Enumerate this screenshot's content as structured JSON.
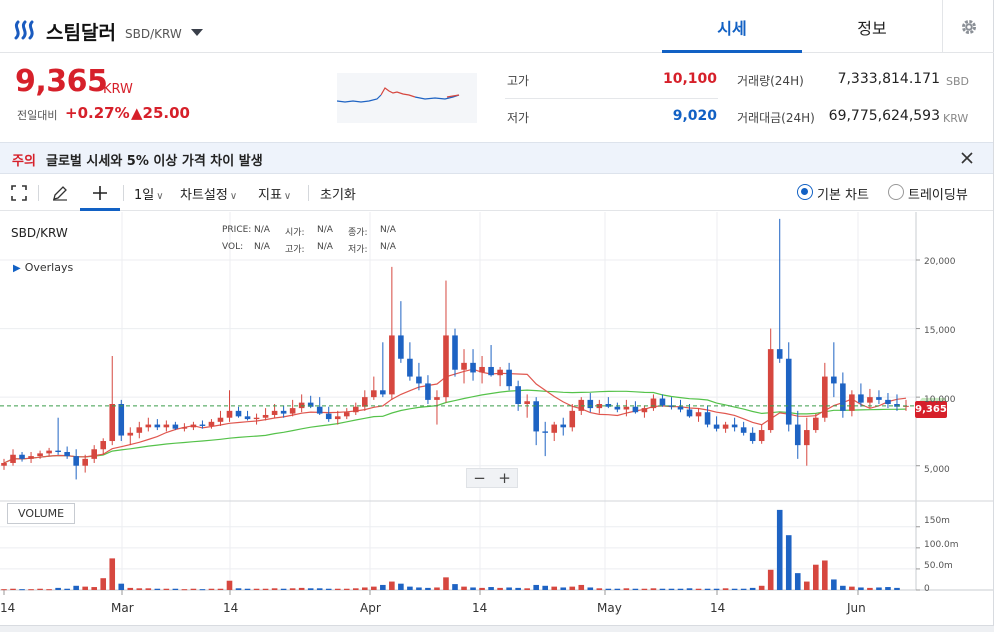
{
  "header": {
    "coin_name": "스팀달러",
    "pair": "SBD/KRW",
    "tabs": [
      "시세",
      "정보"
    ]
  },
  "summary": {
    "price": "9,365",
    "unit": "KRW",
    "change_label": "전일대비",
    "change_pct": "+0.27%",
    "change_abs": "▲25.00",
    "high_label": "고가",
    "high": "10,100",
    "low_label": "저가",
    "low": "9,020",
    "volume_label": "거래량(24H)",
    "volume": "7,333,814.171",
    "volume_unit": "SBD",
    "value_label": "거래대금(24H)",
    "value": "69,775,624,593",
    "value_unit": "KRW"
  },
  "notice": {
    "tag": "주의",
    "text": "글로벌 시세와 5% 이상 가격 차이 발생"
  },
  "toolbar": {
    "interval": "1일",
    "chart_settings": "차트설정",
    "indicators": "지표",
    "reset": "초기화",
    "basic_chart": "기본 차트",
    "tradingview": "트레이딩뷰"
  },
  "chart": {
    "pair": "SBD/KRW",
    "overlays": "Overlays",
    "ohlc": {
      "price_label": "PRICE:",
      "price": "N/A",
      "open_label": "시가:",
      "open": "N/A",
      "close_label": "종가:",
      "close": "N/A",
      "vol_label": "VOL:",
      "vol": "N/A",
      "high_label": "고가:",
      "high": "N/A",
      "low_label": "저가:",
      "low": "N/A"
    },
    "volume_label": "VOLUME",
    "last_price": "9,365",
    "zoom_minus": "−",
    "zoom_plus": "+",
    "y_ticks": [
      "20,000",
      "15,000",
      "10,000",
      "5,000"
    ],
    "vol_ticks": [
      "150m",
      "100.0m",
      "50.0m",
      "0"
    ],
    "x_ticks": [
      "14",
      "Mar",
      "14",
      "Apr",
      "14",
      "May",
      "14",
      "Jun"
    ],
    "colors": {
      "up": "#d6473f",
      "down": "#1e63c3",
      "ma_short": "#e0574f",
      "ma_long": "#55c24a",
      "accent": "#1261c4"
    }
  },
  "chart_data": {
    "type": "candlestick",
    "series": [
      {
        "name": "OHLC",
        "values": [
          [
            5000,
            5500,
            4700,
            5200
          ],
          [
            5200,
            6200,
            5000,
            5800
          ],
          [
            5800,
            6000,
            5300,
            5500
          ],
          [
            5500,
            6000,
            5200,
            5700
          ],
          [
            5700,
            6100,
            5500,
            5900
          ],
          [
            5900,
            6300,
            5700,
            6100
          ],
          [
            6100,
            8500,
            5800,
            6000
          ],
          [
            6000,
            6400,
            5500,
            5700
          ],
          [
            5700,
            6200,
            4000,
            5000
          ],
          [
            5000,
            5800,
            4500,
            5500
          ],
          [
            5500,
            6500,
            5200,
            6200
          ],
          [
            6200,
            7000,
            5800,
            6800
          ],
          [
            6800,
            13000,
            6500,
            9500
          ],
          [
            9500,
            9800,
            6800,
            7200
          ],
          [
            7200,
            7800,
            6500,
            7400
          ],
          [
            7400,
            8200,
            7000,
            7800
          ],
          [
            7800,
            8500,
            7500,
            8000
          ],
          [
            8000,
            8400,
            7600,
            7800
          ],
          [
            7800,
            8300,
            7500,
            8000
          ],
          [
            8000,
            8200,
            7600,
            7700
          ],
          [
            7700,
            8100,
            7500,
            7800
          ],
          [
            7800,
            8200,
            7600,
            8000
          ],
          [
            8000,
            8300,
            7700,
            7900
          ],
          [
            7900,
            8400,
            7700,
            8200
          ],
          [
            8200,
            9000,
            7900,
            8500
          ],
          [
            8500,
            10500,
            8200,
            9000
          ],
          [
            9000,
            9300,
            8500,
            8600
          ],
          [
            8600,
            9000,
            8300,
            8400
          ],
          [
            8400,
            8800,
            8000,
            8500
          ],
          [
            8500,
            9200,
            8300,
            8700
          ],
          [
            8700,
            9500,
            8500,
            9000
          ],
          [
            9000,
            9400,
            8500,
            8800
          ],
          [
            8800,
            9800,
            8600,
            9200
          ],
          [
            9200,
            10200,
            8900,
            9600
          ],
          [
            9600,
            10100,
            9200,
            9300
          ],
          [
            9300,
            10000,
            8700,
            8800
          ],
          [
            8800,
            9300,
            8200,
            8400
          ],
          [
            8400,
            9000,
            8000,
            8600
          ],
          [
            8600,
            9200,
            8400,
            8900
          ],
          [
            8900,
            9600,
            8700,
            9300
          ],
          [
            9300,
            10500,
            9000,
            10000
          ],
          [
            10000,
            11500,
            9800,
            10500
          ],
          [
            10500,
            14000,
            10000,
            10200
          ],
          [
            10200,
            19500,
            9800,
            14500
          ],
          [
            14500,
            17000,
            12500,
            12800
          ],
          [
            12800,
            14000,
            11200,
            11500
          ],
          [
            11500,
            12500,
            10500,
            11000
          ],
          [
            11000,
            11600,
            9500,
            9800
          ],
          [
            9800,
            10500,
            8000,
            10000
          ],
          [
            10000,
            18500,
            9600,
            14500
          ],
          [
            14500,
            15000,
            11500,
            12000
          ],
          [
            12000,
            13500,
            11000,
            12500
          ],
          [
            12500,
            13500,
            11200,
            11800
          ],
          [
            11800,
            13000,
            11000,
            12200
          ],
          [
            12200,
            13800,
            11500,
            11600
          ],
          [
            11600,
            12200,
            10800,
            12000
          ],
          [
            12000,
            12500,
            10500,
            10800
          ],
          [
            10800,
            11200,
            9000,
            9500
          ],
          [
            9500,
            10200,
            8500,
            9700
          ],
          [
            9700,
            10000,
            6500,
            7500
          ],
          [
            7500,
            8200,
            5700,
            7400
          ],
          [
            7400,
            8200,
            6800,
            8000
          ],
          [
            8000,
            8500,
            7200,
            7800
          ],
          [
            7800,
            9500,
            7500,
            9000
          ],
          [
            9000,
            10000,
            8700,
            9800
          ],
          [
            9800,
            10300,
            8900,
            9200
          ],
          [
            9200,
            9800,
            8800,
            9500
          ],
          [
            9500,
            10000,
            9200,
            9300
          ],
          [
            9300,
            9600,
            8900,
            9100
          ],
          [
            9100,
            9800,
            8600,
            9300
          ],
          [
            9300,
            9700,
            8800,
            8900
          ],
          [
            8900,
            9400,
            8500,
            9200
          ],
          [
            9200,
            10200,
            9000,
            9900
          ],
          [
            9900,
            10200,
            9300,
            9400
          ],
          [
            9400,
            10000,
            9100,
            9300
          ],
          [
            9300,
            9800,
            8900,
            9100
          ],
          [
            9100,
            9500,
            8500,
            8600
          ],
          [
            8600,
            9200,
            8200,
            8900
          ],
          [
            8900,
            9400,
            7800,
            8000
          ],
          [
            8000,
            8600,
            7500,
            7700
          ],
          [
            7700,
            8200,
            7400,
            8000
          ],
          [
            8000,
            8500,
            7500,
            7800
          ],
          [
            7800,
            8200,
            7200,
            7400
          ],
          [
            7400,
            7800,
            6600,
            6800
          ],
          [
            6800,
            8000,
            6600,
            7600
          ],
          [
            7600,
            15000,
            7400,
            13500
          ],
          [
            13500,
            23000,
            12500,
            12800
          ],
          [
            12800,
            14000,
            7500,
            8000
          ],
          [
            8000,
            9000,
            5500,
            6500
          ],
          [
            6500,
            8500,
            5000,
            7600
          ],
          [
            7600,
            8800,
            7400,
            8500
          ],
          [
            8500,
            12500,
            8200,
            11500
          ],
          [
            11500,
            14000,
            10000,
            11000
          ],
          [
            11000,
            11800,
            8500,
            9000
          ],
          [
            9000,
            10500,
            8600,
            10200
          ],
          [
            10200,
            11000,
            9300,
            9600
          ],
          [
            9600,
            10600,
            9200,
            10000
          ],
          [
            10000,
            10500,
            9500,
            9800
          ],
          [
            9800,
            10300,
            9200,
            9500
          ],
          [
            9500,
            10200,
            9000,
            9300
          ],
          [
            9300,
            9800,
            9000,
            9365
          ]
        ]
      }
    ],
    "volumes_m": [
      2,
      3,
      2,
      2,
      3,
      2,
      5,
      3,
      10,
      8,
      7,
      28,
      75,
      15,
      5,
      4,
      4,
      3,
      3,
      3,
      2,
      3,
      2,
      3,
      3,
      22,
      4,
      3,
      3,
      3,
      4,
      3,
      4,
      5,
      4,
      4,
      3,
      3,
      3,
      4,
      6,
      8,
      12,
      20,
      15,
      8,
      6,
      5,
      6,
      30,
      14,
      8,
      6,
      5,
      7,
      5,
      6,
      5,
      4,
      12,
      10,
      8,
      6,
      8,
      12,
      6,
      4,
      3,
      3,
      4,
      3,
      3,
      4,
      3,
      3,
      3,
      4,
      3,
      3,
      3,
      4,
      3,
      3,
      5,
      10,
      48,
      190,
      130,
      40,
      20,
      60,
      70,
      25,
      10,
      8,
      6,
      5,
      6,
      7,
      5
    ],
    "y_range": [
      2500,
      23500
    ],
    "vol_range": [
      0,
      185
    ],
    "grid": true
  }
}
